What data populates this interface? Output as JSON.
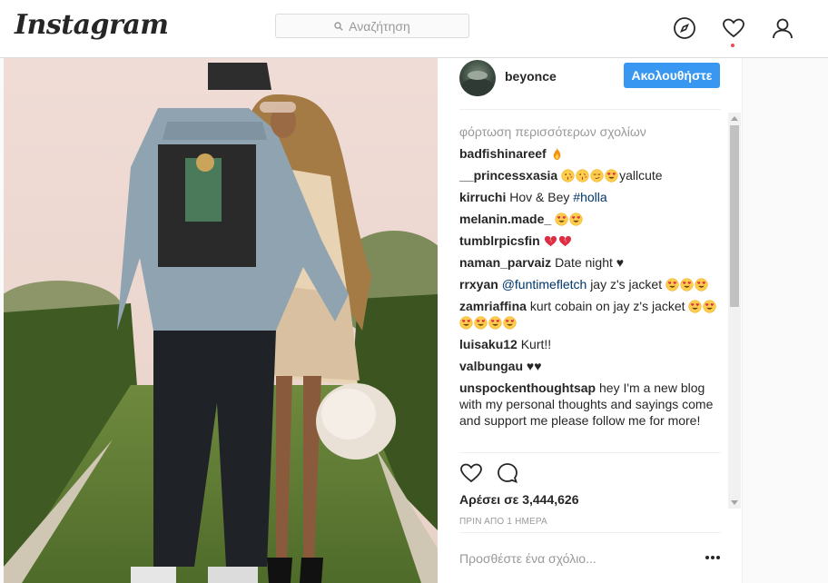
{
  "nav": {
    "logo": "Instagram",
    "search_placeholder": "Αναζήτηση"
  },
  "post": {
    "username": "beyonce",
    "follow_label": "Ακολουθήστε",
    "load_more": "φόρτωση περισσότερων σχολίων",
    "comments": [
      {
        "user": "badfishinareef",
        "text": "",
        "emojis": [
          "fire"
        ]
      },
      {
        "user": "__princessxasia",
        "text": "yallcute",
        "emojis": [
          "kiss-face",
          "kiss-face",
          "smirk-face",
          "heart-eyes"
        ]
      },
      {
        "user": "kirruchi",
        "text": "Hov & Bey",
        "mention": "#holla"
      },
      {
        "user": "melanin.made_",
        "text": "",
        "emojis": [
          "heart-eyes",
          "heart-eyes"
        ]
      },
      {
        "user": "tumblrpicsfin",
        "text": "",
        "emojis": [
          "broken-heart",
          "broken-heart"
        ]
      },
      {
        "user": "naman_parvaiz",
        "text": "Date night ♥"
      },
      {
        "user": "rrxyan",
        "mention": "@funtimefletch",
        "text": "jay z's jacket",
        "emojis": [
          "heart-eyes",
          "heart-eyes",
          "heart-eyes"
        ]
      },
      {
        "user": "zamriaffina",
        "text": "kurt cobain on jay z's jacket",
        "emojis": [
          "heart-eyes",
          "heart-eyes",
          "heart-eyes",
          "heart-eyes",
          "heart-eyes",
          "heart-eyes"
        ]
      },
      {
        "user": "luisaku12",
        "text": "Kurt!!"
      },
      {
        "user": "valbungau",
        "text": "♥♥"
      },
      {
        "user": "unspockenthoughtsap",
        "text": "hey I'm a new blog with my personal thoughts and sayings come and support me please follow me for more!"
      }
    ],
    "likes": "Αρέσει σε 3,444,626",
    "time": "ΠΡΙΝ ΑΠΟ 1 ΗΜΕΡΑ",
    "add_comment_placeholder": "Προσθέστε ένα σχόλιο..."
  }
}
